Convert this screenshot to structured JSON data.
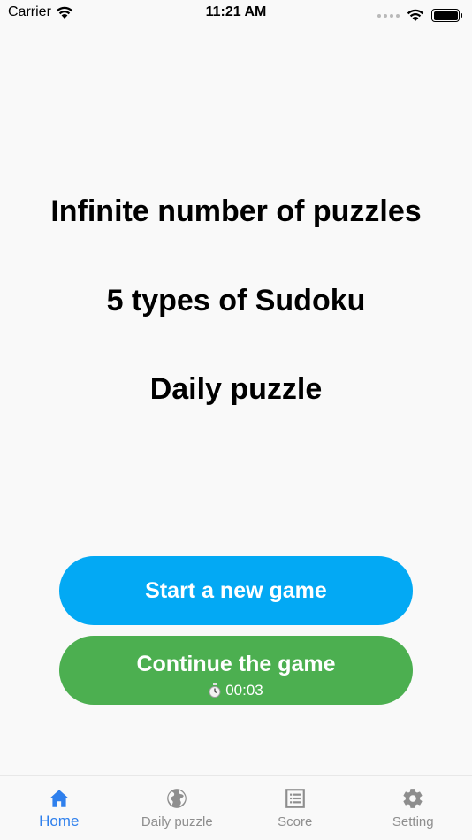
{
  "status_bar": {
    "carrier": "Carrier",
    "time": "11:21 AM"
  },
  "features": [
    "Infinite number of puzzles",
    "5 types of Sudoku",
    "Daily puzzle"
  ],
  "buttons": {
    "new_game": "Start a new game",
    "continue_game": "Continue the game",
    "elapsed_time": "00:03"
  },
  "tabs": [
    {
      "label": "Home",
      "icon": "home-icon",
      "active": true
    },
    {
      "label": "Daily puzzle",
      "icon": "globe-icon",
      "active": false
    },
    {
      "label": "Score",
      "icon": "list-icon",
      "active": false
    },
    {
      "label": "Setting",
      "icon": "gear-icon",
      "active": false
    }
  ],
  "colors": {
    "new_game_button": "#03a9f4",
    "continue_button": "#4caf50",
    "active_tab": "#2f80ed",
    "inactive_tab": "#8e8e8e",
    "background": "#f9f9f9"
  }
}
